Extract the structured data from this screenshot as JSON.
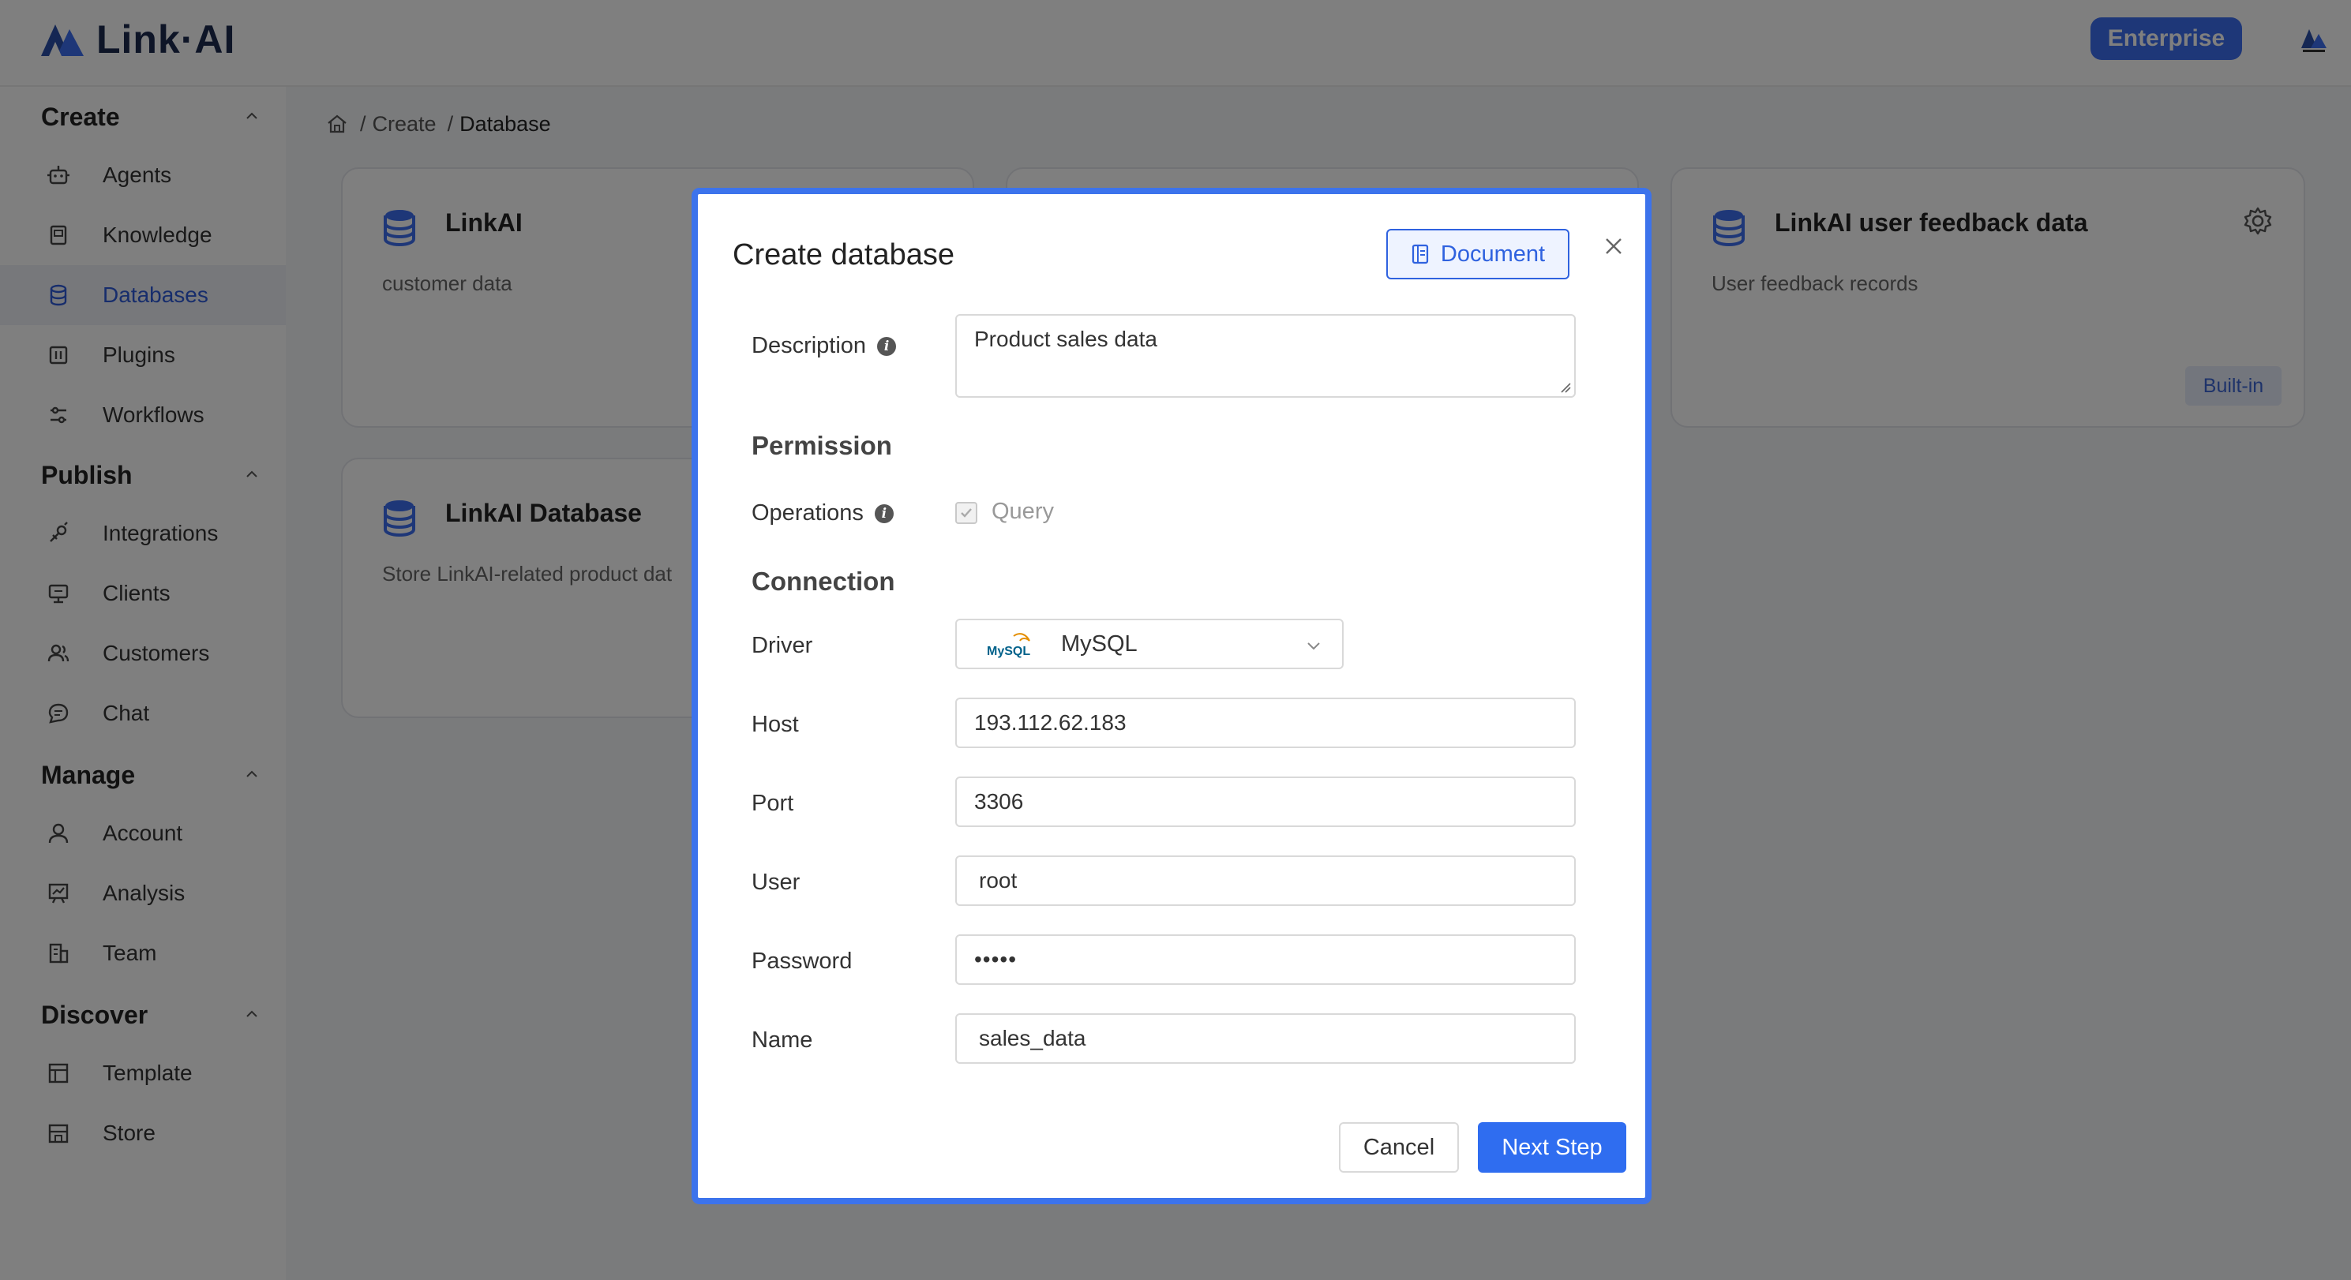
{
  "header": {
    "logo_text": "Link·AI",
    "enterprise_label": "Enterprise"
  },
  "sidebar": {
    "sections": [
      {
        "title": "Create",
        "items": [
          {
            "label": "Agents",
            "icon": "robot-icon"
          },
          {
            "label": "Knowledge",
            "icon": "book-icon"
          },
          {
            "label": "Databases",
            "icon": "database-icon",
            "active": true
          },
          {
            "label": "Plugins",
            "icon": "plugin-icon"
          },
          {
            "label": "Workflows",
            "icon": "workflow-icon"
          }
        ]
      },
      {
        "title": "Publish",
        "items": [
          {
            "label": "Integrations",
            "icon": "integration-icon"
          },
          {
            "label": "Clients",
            "icon": "monitor-icon"
          },
          {
            "label": "Customers",
            "icon": "users-icon"
          },
          {
            "label": "Chat",
            "icon": "chat-icon"
          }
        ]
      },
      {
        "title": "Manage",
        "items": [
          {
            "label": "Account",
            "icon": "user-icon"
          },
          {
            "label": "Analysis",
            "icon": "chart-icon"
          },
          {
            "label": "Team",
            "icon": "building-icon"
          }
        ]
      },
      {
        "title": "Discover",
        "items": [
          {
            "label": "Template",
            "icon": "template-icon"
          },
          {
            "label": "Store",
            "icon": "store-icon"
          }
        ]
      }
    ]
  },
  "breadcrumb": {
    "items": [
      "Create",
      "Database"
    ]
  },
  "cards": [
    {
      "title": "LinkAI",
      "description": "customer data"
    },
    {
      "title": "LinkAI user feedback data",
      "description": "User feedback records",
      "badge": "Built-in"
    },
    {
      "title": "LinkAI Database",
      "description": "Store LinkAI-related product dat"
    }
  ],
  "modal": {
    "title": "Create database",
    "document_label": "Document",
    "description_label": "Description",
    "description_value": "Product sales data",
    "permission_title": "Permission",
    "operations_label": "Operations",
    "query_label": "Query",
    "connection_title": "Connection",
    "driver_label": "Driver",
    "driver_value": "MySQL",
    "mysql_logo_text": "MySQL",
    "host_label": "Host",
    "host_value": "193.112.62.183",
    "port_label": "Port",
    "port_value": "3306",
    "user_label": "User",
    "user_value": "root",
    "password_label": "Password",
    "password_value": "•••••",
    "name_label": "Name",
    "name_value": "sales_data",
    "cancel_label": "Cancel",
    "next_label": "Next Step"
  },
  "colors": {
    "accent": "#2f6df0",
    "modal_border": "#3c73ec",
    "active_nav_bg": "#eef0f6"
  }
}
